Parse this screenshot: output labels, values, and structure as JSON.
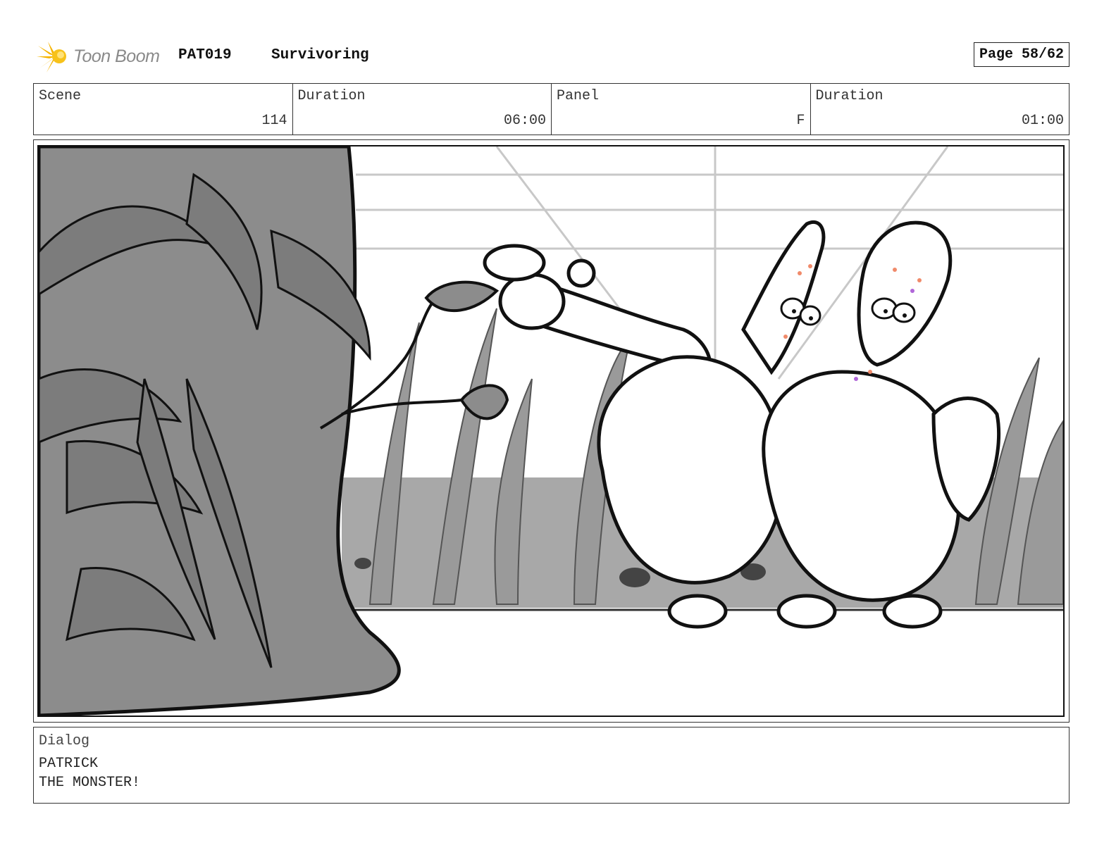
{
  "header": {
    "logo_text": "Toon Boom",
    "project_code": "PAT019",
    "project_title": "Survivoring",
    "page": "Page 58/62"
  },
  "info": {
    "scene_label": "Scene",
    "scene_value": "114",
    "scene_duration_label": "Duration",
    "scene_duration_value": "06:00",
    "panel_label": "Panel",
    "panel_value": "F",
    "panel_duration_label": "Duration",
    "panel_duration_value": "01:00"
  },
  "panel": {
    "image_icon": "storyboard-sketch-icon"
  },
  "dialog": {
    "label": "Dialog",
    "speaker": "PATRICK",
    "line": "THE MONSTER!"
  },
  "colors": {
    "logo_accent": "#f5b400",
    "logo_text": "#8a8a8a",
    "plant_gray": "#8c8c8c",
    "background_gray": "#a8a8a8",
    "line": "#111111"
  }
}
